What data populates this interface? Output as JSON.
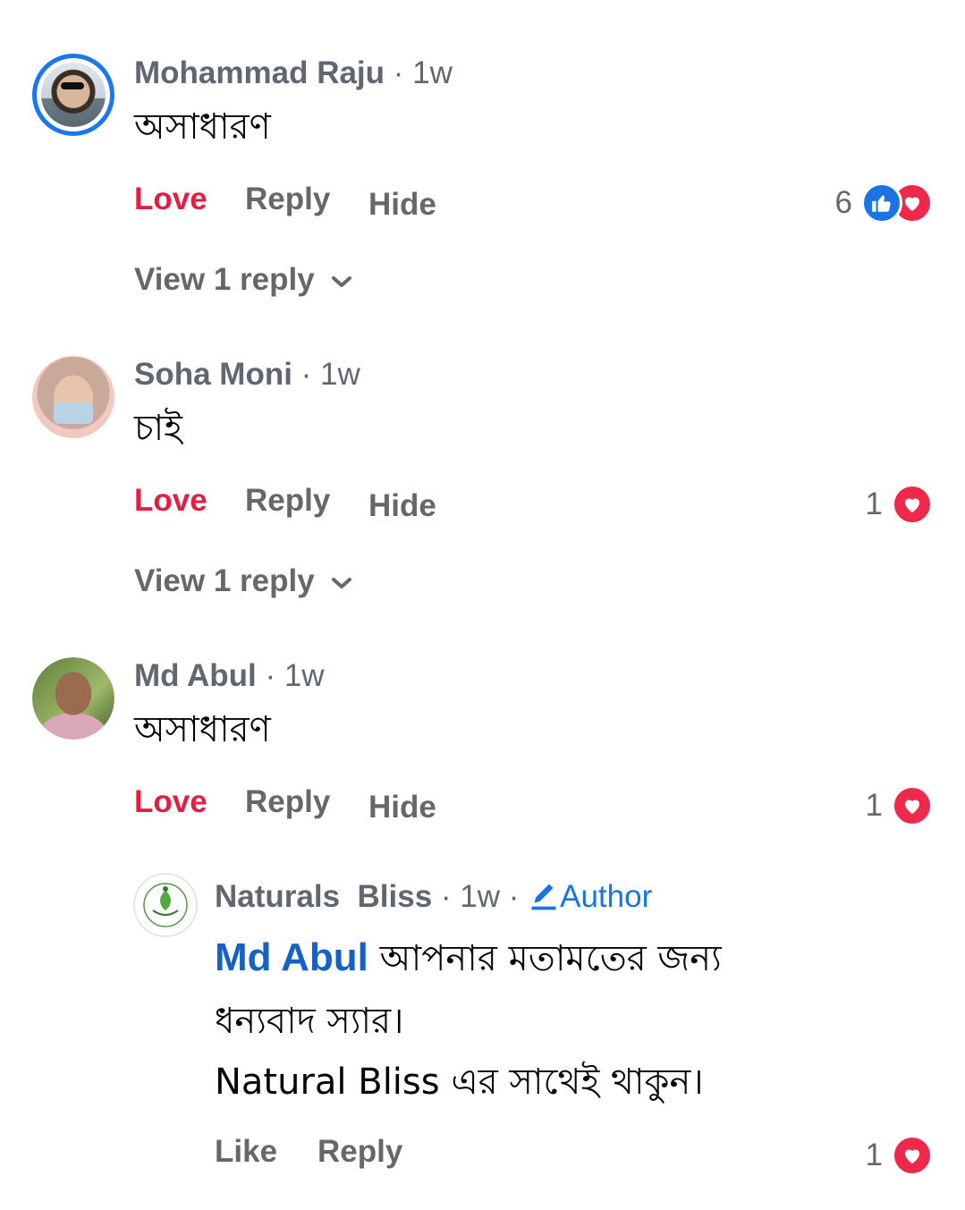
{
  "comments": [
    {
      "author": "Mohammad Raju",
      "time": "1w",
      "text": "অসাধারণ",
      "actions": {
        "love": "Love",
        "reply": "Reply",
        "hide": "Hide"
      },
      "reaction_count": "6",
      "reactions": [
        "like-icon",
        "love-icon"
      ],
      "view_replies": "View 1 reply"
    },
    {
      "author": "Soha Moni",
      "time": "1w",
      "text": "চাই",
      "actions": {
        "love": "Love",
        "reply": "Reply",
        "hide": "Hide"
      },
      "reaction_count": "1",
      "reactions": [
        "love-icon"
      ],
      "view_replies": "View 1 reply"
    },
    {
      "author": "Md Abul",
      "time": "1w",
      "text": "অসাধারণ",
      "actions": {
        "love": "Love",
        "reply": "Reply",
        "hide": "Hide"
      },
      "reaction_count": "1",
      "reactions": [
        "love-icon"
      ]
    }
  ],
  "reply": {
    "author": "Naturals  Bliss",
    "time": "1w",
    "badge": "Author",
    "mention": "Md Abul",
    "line1": "আপনার মতামতের জন্য",
    "line2": "ধন্যবাদ স্যার।",
    "line3": "Natural Bliss এর সাথেই থাকুন।",
    "actions": {
      "like": "Like",
      "reply": "Reply"
    },
    "reaction_count": "1",
    "reactions": [
      "love-icon"
    ]
  },
  "colors": {
    "love_action": "#e41e3f",
    "like_reaction": "#1b74e4",
    "love_reaction": "#f02849",
    "story_ring": "#1877f2",
    "mention": "#1461c7",
    "secondary_text": "#65676b"
  }
}
